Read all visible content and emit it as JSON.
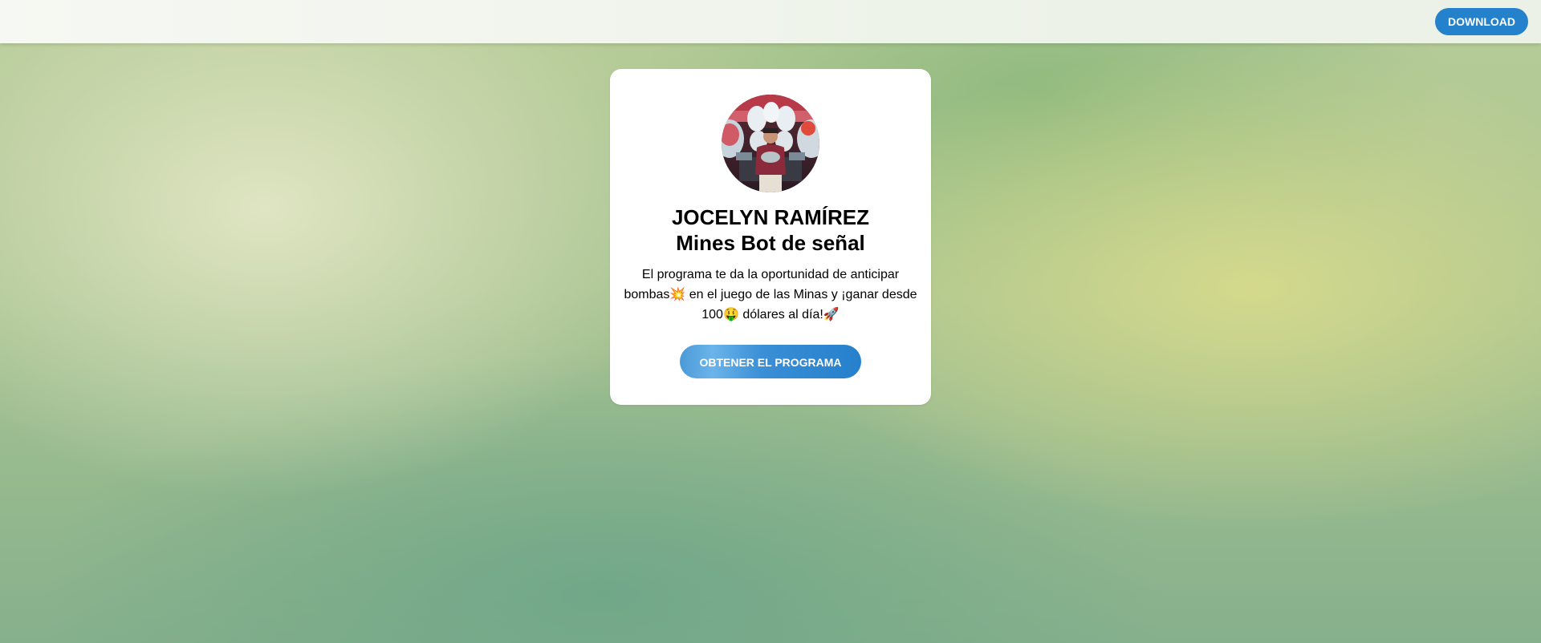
{
  "header": {
    "download_label": "DOWNLOAD",
    "accent_color": "#2481cc"
  },
  "card": {
    "avatar_icon": "profile-photo",
    "name": "JOCELYN RAMÍREZ",
    "subtitle": "Mines Bot de señal",
    "description": "El programa te da la oportunidad de anticipar bombas💥 en el juego de las Minas y ¡ganar desde 100🤑 dólares al día!🚀",
    "cta_label": "OBTENER EL PROGRAMA"
  }
}
